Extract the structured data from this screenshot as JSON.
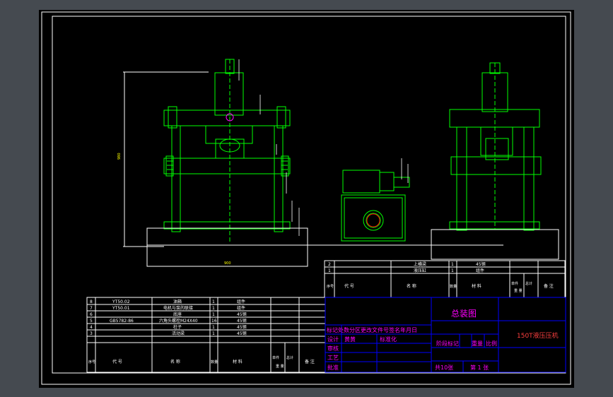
{
  "window": {
    "background_color": "#454a50",
    "viewport_color": "#000000"
  },
  "colors": {
    "frame": "#ffffff",
    "geometry": "#00ff00",
    "dimension": "#ffffff",
    "title_text": "#ff00ff",
    "table_text": "#ffffff",
    "title_line": "#0000ff",
    "accent": "#ff00ff"
  },
  "drawing": {
    "dimension_height": "980",
    "dimension_width": "900"
  },
  "parts_table_upper": {
    "rows": [
      {
        "no": "2",
        "code": "",
        "name": "上横梁",
        "qty": "1",
        "material": "45钢",
        "remark": ""
      },
      {
        "no": "1",
        "code": "",
        "name": "液压缸",
        "qty": "1",
        "material": "组件",
        "remark": ""
      }
    ],
    "header": {
      "no": "序号",
      "code": "代    号",
      "name": "名    称",
      "qty": "数量",
      "material": "材    料",
      "unit_weight": "单件",
      "total_weight": "总计",
      "weight": "重  量",
      "remark": "备  注"
    }
  },
  "parts_table_lower": {
    "rows": [
      {
        "no": "8",
        "code": "YT50.02",
        "name": "油箱",
        "qty": "1",
        "material": "组件"
      },
      {
        "no": "7",
        "code": "YT50.01",
        "name": "电机与泵的联接",
        "qty": "1",
        "material": "组件"
      },
      {
        "no": "6",
        "code": "",
        "name": "底座",
        "qty": "1",
        "material": "45钢"
      },
      {
        "no": "5",
        "code": "GB5782-86",
        "name": "六角头螺栓M24X40",
        "qty": "16",
        "material": "45钢"
      },
      {
        "no": "4",
        "code": "",
        "name": "柱子",
        "qty": "1",
        "material": "45钢"
      },
      {
        "no": "3",
        "code": "",
        "name": "活动梁",
        "qty": "1",
        "material": "45钢"
      }
    ],
    "header": {
      "no": "序号",
      "code": "代    号",
      "name": "名    称",
      "qty": "数量",
      "material": "材    料",
      "unit_weight": "单件",
      "total_weight": "总计",
      "weight": "重  量",
      "remark": "备  注"
    }
  },
  "title_block": {
    "drawing_name": "总装图",
    "product_name": "150T液压压机",
    "stage_label": "阶段标记",
    "weight_label": "重量",
    "scale_label": "比例",
    "revision_row": "标记处数分区更改文件号签名年月日",
    "rows_left": [
      {
        "role": "设计",
        "name": "黄黄",
        "std": "标准化"
      },
      {
        "role": "审核",
        "name": "",
        "std": ""
      },
      {
        "role": "工艺",
        "name": "",
        "std": ""
      }
    ],
    "approve_label": "批准",
    "sheet_total": "共10张",
    "sheet_current": "第 1 张"
  }
}
